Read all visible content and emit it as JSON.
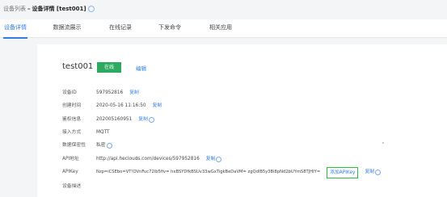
{
  "breadcrumb": {
    "parent": "设备列表",
    "separator": "–",
    "current": "设备详情 [test001]"
  },
  "tabs": [
    {
      "label": "设备详情",
      "active": true
    },
    {
      "label": "数据流展示",
      "active": false
    },
    {
      "label": "在线记录",
      "active": false
    },
    {
      "label": "下发命令",
      "active": false
    },
    {
      "label": "相关应用",
      "active": false
    }
  ],
  "device": {
    "name": "test001",
    "status": "在线",
    "edit_label": "编辑"
  },
  "info": {
    "device_id": {
      "label": "设备ID",
      "value": "597952816",
      "action": "复制"
    },
    "created": {
      "label": "创建时间",
      "value": "2020-05-16 11:16:50",
      "action": "复制"
    },
    "auth": {
      "label": "鉴权信息",
      "value": "202005160951",
      "action": "复制"
    },
    "access": {
      "label": "接入方式",
      "value": "MQTT"
    },
    "privacy": {
      "label": "数据保密性",
      "value": "私密"
    },
    "api_url": {
      "label": "API地址",
      "value": "http://api.heclouds.com/devices/597952816",
      "action": "复制"
    },
    "apikey": {
      "label": "APIKey",
      "value": "Nzp=iCSEbo=VT!OVnFuc72lb5fiv= hxBSYDfkBSUv33wGxTigkBeDaVM= zgQdlB5y3Bi8pNd2bUYmS8TJHIY=",
      "add_label": "添加APIKey",
      "action": "复制"
    },
    "desc": {
      "label": "设备描述"
    }
  },
  "colors": {
    "accent": "#2f7fe0",
    "status_online": "#2eaa60",
    "highlight_border": "#2fbf3a"
  }
}
